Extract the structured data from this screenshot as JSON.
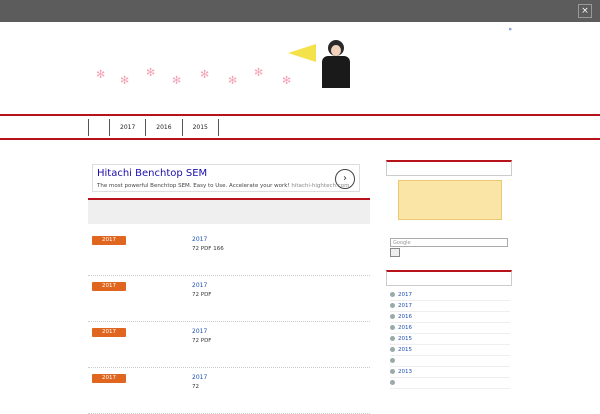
{
  "cookie_bar": {
    "text": "",
    "ok_label": "",
    "close_icon": "close-icon"
  },
  "top_link": {
    "label": ""
  },
  "banner": {
    "title": "",
    "image": "megaphone-girl-illustration"
  },
  "header_description": "",
  "site_tagline": "",
  "nav": {
    "items": [
      {
        "label": ""
      },
      {
        "label": "2017"
      },
      {
        "label": "2016"
      },
      {
        "label": "2015"
      }
    ]
  },
  "ad": {
    "title": "Hitachi Benchtop SEM",
    "text": "The most powerful Benchtop SEM. Easy to Use. Accelerate your work!",
    "url": "hitachi-hightech.com",
    "button_icon": "chevron-right-icon"
  },
  "section": {
    "title": ""
  },
  "posts": [
    {
      "category": "2017",
      "title": "2017",
      "body": "72 PDF 166"
    },
    {
      "category": "2017",
      "title": "2017",
      "body": "72 PDF"
    },
    {
      "category": "2017",
      "title": "2017",
      "body": "72 PDF"
    },
    {
      "category": "2017",
      "title": "2017",
      "body": "72"
    }
  ],
  "sidebar": {
    "links_head": "",
    "banner_text": "",
    "search_placeholder": "Google",
    "search_button": "",
    "archive_head": "",
    "archive": [
      {
        "label": "2017"
      },
      {
        "label": "2017"
      },
      {
        "label": "2016"
      },
      {
        "label": "2016"
      },
      {
        "label": "2015"
      },
      {
        "label": "2015"
      },
      {
        "label": ""
      },
      {
        "label": "2013"
      },
      {
        "label": ""
      }
    ]
  },
  "colors": {
    "accent_red": "#b8121b",
    "category_orange": "#e0651f",
    "link_blue": "#1e50b4"
  }
}
